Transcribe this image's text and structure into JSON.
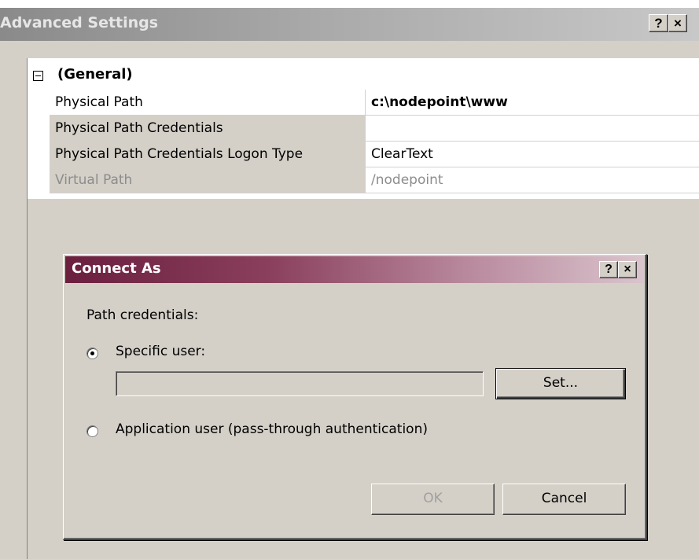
{
  "outer_window": {
    "title": "Advanced Settings",
    "help_label": "?",
    "close_label": "×"
  },
  "property_grid": {
    "category": {
      "label": "(General)"
    },
    "rows": [
      {
        "name": "Physical Path",
        "value": "c:\\nodepoint\\www"
      },
      {
        "name": "Physical Path Credentials",
        "value": ""
      },
      {
        "name": "Physical Path Credentials Logon Type",
        "value": "ClearText"
      },
      {
        "name": "Virtual Path",
        "value": "/nodepoint"
      }
    ]
  },
  "connect_as_dialog": {
    "title": "Connect As",
    "help_label": "?",
    "close_label": "×",
    "section_label": "Path credentials:",
    "specific_user": {
      "label": "Specific user:",
      "selected": true,
      "value": ""
    },
    "set_button": "Set...",
    "application_user": {
      "label": "Application user (pass-through authentication)",
      "selected": false
    },
    "ok_button": "OK",
    "cancel_button": "Cancel"
  }
}
